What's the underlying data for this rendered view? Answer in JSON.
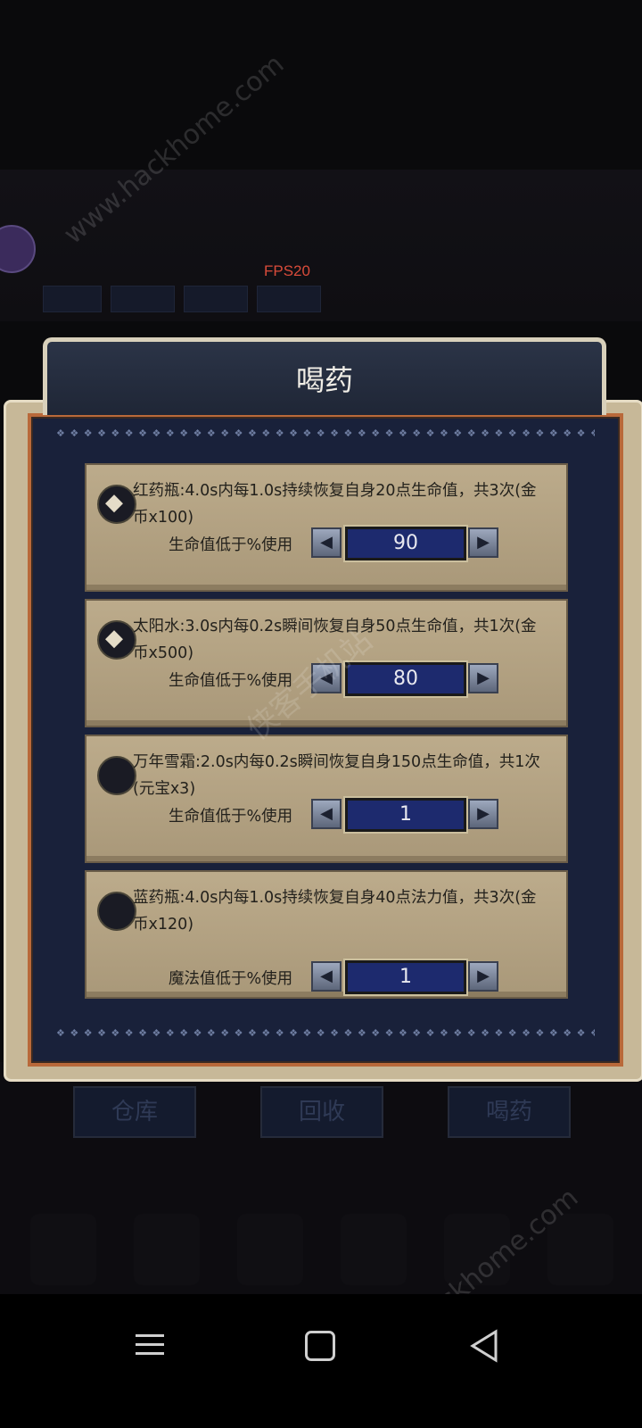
{
  "hud": {
    "fps": "FPS20"
  },
  "dialog": {
    "title": "喝药",
    "items": [
      {
        "desc": "红药瓶:4.0s内每1.0s持续恢复自身20点生命值，共3次(金币x100)",
        "threshold_label": "生命值低于%使用",
        "value": "90",
        "selected_icon": true
      },
      {
        "desc": "太阳水:3.0s内每0.2s瞬间恢复自身50点生命值，共1次(金币x500)",
        "threshold_label": "生命值低于%使用",
        "value": "80",
        "selected_icon": true
      },
      {
        "desc": "万年雪霜:2.0s内每0.2s瞬间恢复自身150点生命值，共1次(元宝x3)",
        "threshold_label": "生命值低于%使用",
        "value": "1",
        "selected_icon": false
      },
      {
        "desc": "蓝药瓶:4.0s内每1.0s持续恢复自身40点法力值，共3次(金币x120)",
        "threshold_label": "魔法值低于%使用",
        "value": "1",
        "selected_icon": false
      }
    ]
  },
  "bottom_buttons": {
    "warehouse": "仓库",
    "recycle": "回收",
    "drink": "喝药"
  },
  "watermark": {
    "url": "www.hackhome.com",
    "cn": "侠客手机站"
  },
  "colors": {
    "accent_value_box": "#1d2a6e",
    "panel_bg": "#19213a",
    "fps_color": "#d84b3a"
  }
}
